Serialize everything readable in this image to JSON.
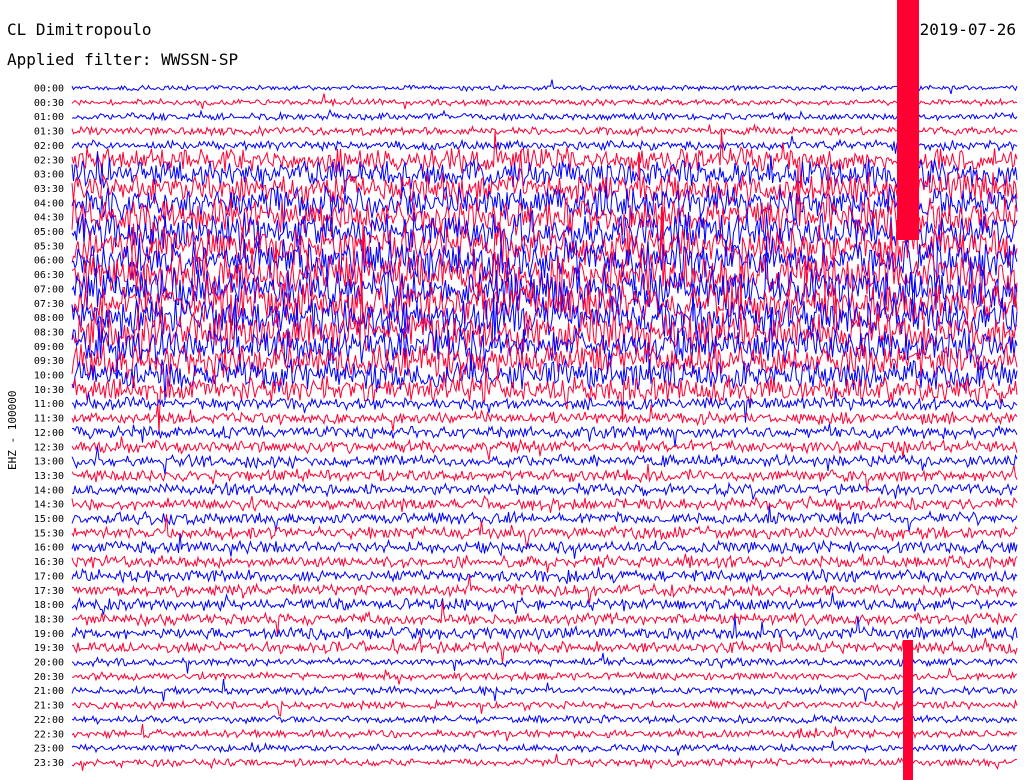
{
  "header": {
    "station": "CL Dimitropoulo",
    "filter": "Applied filter: WWSSN-SP",
    "date": "2019-07-26"
  },
  "chart_data": {
    "type": "line",
    "ylabel": "EHZ - 100000",
    "x_range_minutes": [
      0,
      30
    ],
    "y_ticks": [
      "00:00",
      "00:30",
      "01:00",
      "01:30",
      "02:00",
      "02:30",
      "03:00",
      "03:30",
      "04:00",
      "04:30",
      "05:00",
      "05:30",
      "06:00",
      "06:30",
      "07:00",
      "07:30",
      "08:00",
      "08:30",
      "09:00",
      "09:30",
      "10:00",
      "10:30",
      "11:00",
      "11:30",
      "12:00",
      "12:30",
      "13:00",
      "13:30",
      "14:00",
      "14:30",
      "15:00",
      "15:30",
      "16:00",
      "16:30",
      "17:00",
      "17:30",
      "18:00",
      "18:30",
      "19:00",
      "19:30",
      "20:00",
      "20:30",
      "21:00",
      "21:30",
      "22:00",
      "22:30",
      "23:00",
      "23:30"
    ],
    "trace_colors": [
      "#0000ff",
      "#ff0033"
    ],
    "background": "#ffffff",
    "grid": false
  }
}
